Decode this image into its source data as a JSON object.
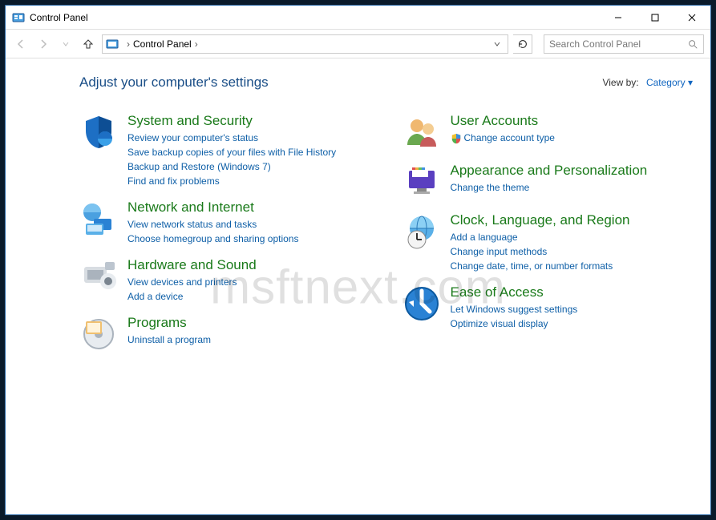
{
  "window": {
    "title": "Control Panel"
  },
  "nav": {
    "breadcrumb_root": "Control Panel",
    "search_placeholder": "Search Control Panel"
  },
  "header": {
    "title": "Adjust your computer's settings",
    "viewby_label": "View by:",
    "viewby_value": "Category"
  },
  "left": [
    {
      "title": "System and Security",
      "links": [
        "Review your computer's status",
        "Save backup copies of your files with File History",
        "Backup and Restore (Windows 7)",
        "Find and fix problems"
      ]
    },
    {
      "title": "Network and Internet",
      "links": [
        "View network status and tasks",
        "Choose homegroup and sharing options"
      ]
    },
    {
      "title": "Hardware and Sound",
      "links": [
        "View devices and printers",
        "Add a device"
      ]
    },
    {
      "title": "Programs",
      "links": [
        "Uninstall a program"
      ]
    }
  ],
  "right": [
    {
      "title": "User Accounts",
      "links": [
        "Change account type"
      ],
      "shield_on_first": true
    },
    {
      "title": "Appearance and Personalization",
      "links": [
        "Change the theme"
      ]
    },
    {
      "title": "Clock, Language, and Region",
      "links": [
        "Add a language",
        "Change input methods",
        "Change date, time, or number formats"
      ]
    },
    {
      "title": "Ease of Access",
      "links": [
        "Let Windows suggest settings",
        "Optimize visual display"
      ]
    }
  ],
  "watermark": "msftnext.com"
}
